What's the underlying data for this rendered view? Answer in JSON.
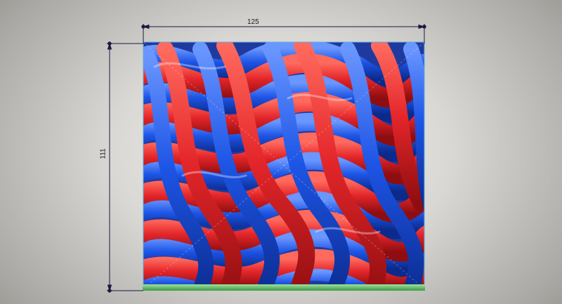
{
  "model_view": {
    "dimensions": {
      "width_label": "125",
      "height_label": "111"
    },
    "colors": {
      "strand_red": "#e4262a",
      "strand_blue": "#1d55e6",
      "base_plate": "#69c86a",
      "dimension_line": "#1a1a40",
      "bounding_box": "#59a8e0",
      "background_center": "#f3f3f1",
      "background_edge": "#86857f"
    }
  }
}
